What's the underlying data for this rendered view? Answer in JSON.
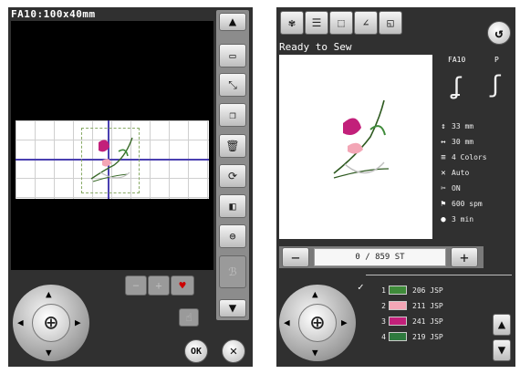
{
  "left": {
    "title": "FA10:100x40mm",
    "side_buttons": [
      "arrow-up",
      "rotate-frame",
      "resize",
      "duplicate",
      "delete",
      "rotate",
      "mirror",
      "border",
      "texture",
      "arrow-down"
    ],
    "bottom_row": {
      "minus": "−",
      "plus": "+",
      "heart": "♥"
    },
    "ok_label": "OK",
    "close_label": "✕"
  },
  "right": {
    "status": "Ready to Sew",
    "foot_labels": [
      "FA10",
      "P"
    ],
    "info": [
      {
        "icon": "height-icon",
        "glyph": "↕",
        "text": "33 mm"
      },
      {
        "icon": "width-icon",
        "glyph": "↔",
        "text": "30 mm"
      },
      {
        "icon": "colors-icon",
        "glyph": "≡",
        "text": "4 Colors"
      },
      {
        "icon": "tension-icon",
        "glyph": "✕",
        "text": "Auto"
      },
      {
        "icon": "cut-icon",
        "glyph": "✂",
        "text": "ON"
      },
      {
        "icon": "speed-icon",
        "glyph": "⚑",
        "text": "600 spm"
      },
      {
        "icon": "clock-icon",
        "glyph": "●",
        "text": "3 min"
      }
    ],
    "counter": {
      "minus": "−",
      "value": "0 / 859 ST",
      "plus": "+"
    },
    "colors": [
      {
        "num": "1",
        "code": "206 JSP",
        "color": "#3f8b3a"
      },
      {
        "num": "2",
        "code": "211 JSP",
        "color": "#f3a6b6"
      },
      {
        "num": "3",
        "code": "241 JSP",
        "color": "#c2207a"
      },
      {
        "num": "4",
        "code": "219 JSP",
        "color": "#2e7a3e"
      }
    ],
    "check_mark": "✓"
  }
}
